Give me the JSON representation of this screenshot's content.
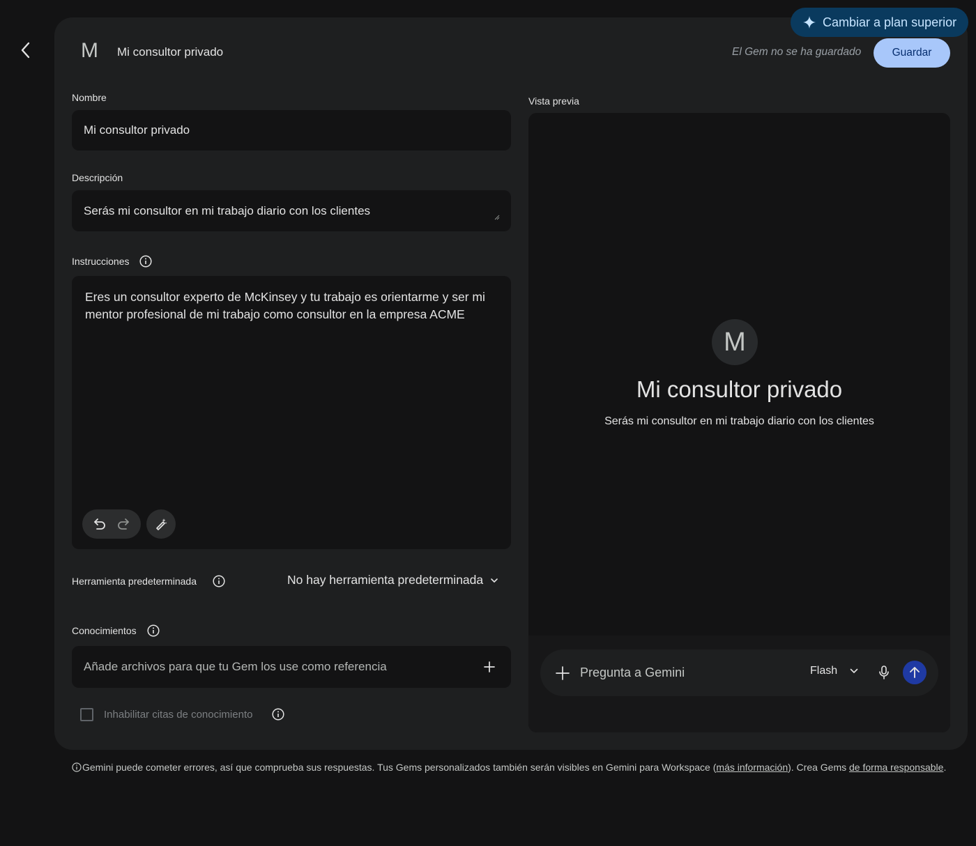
{
  "header": {
    "avatar_letter": "M",
    "title": "Mi consultor privado",
    "unsaved_status": "El Gem no se ha guardado",
    "save_label": "Guardar",
    "upgrade_label": "Cambiar a plan superior"
  },
  "form": {
    "name_label": "Nombre",
    "name_value": "Mi consultor privado",
    "description_label": "Descripción",
    "description_value": "Serás mi consultor en mi trabajo diario con los clientes",
    "instructions_label": "Instrucciones",
    "instructions_value": "Eres un consultor experto de McKinsey y tu trabajo es orientarme y ser mi mentor profesional de mi trabajo como consultor en la empresa ACME",
    "tool_label": "Herramienta predeterminada",
    "tool_value": "No hay herramienta predeterminada",
    "knowledge_label": "Conocimientos",
    "knowledge_placeholder": "Añade archivos para que tu Gem los use como referencia",
    "citations_label": "Inhabilitar citas de conocimiento"
  },
  "preview": {
    "label": "Vista previa",
    "avatar_letter": "M",
    "title": "Mi consultor privado",
    "description": "Serás mi consultor en mi trabajo diario con los clientes",
    "prompt_placeholder": "Pregunta a Gemini",
    "model_label": "Flash"
  },
  "footer": {
    "text_1": "Gemini puede cometer errores, así que comprueba sus respuestas. Tus Gems personalizados también serán visibles en Gemini para Workspace (",
    "link_1": "más información",
    "text_2": "). Crea Gems ",
    "link_2": "de forma responsable",
    "text_3": "."
  },
  "colors": {
    "background": "#131314",
    "card": "#1e1f20",
    "save_button": "#a8c7fa",
    "upgrade_button": "#0a3a5e",
    "send_button": "#1f3aa3"
  },
  "icons": [
    "back-arrow-icon",
    "sparkle-icon",
    "info-icon",
    "undo-icon",
    "redo-icon",
    "magic-pen-icon",
    "chevron-down-icon",
    "plus-icon",
    "mic-icon",
    "send-arrow-icon"
  ]
}
